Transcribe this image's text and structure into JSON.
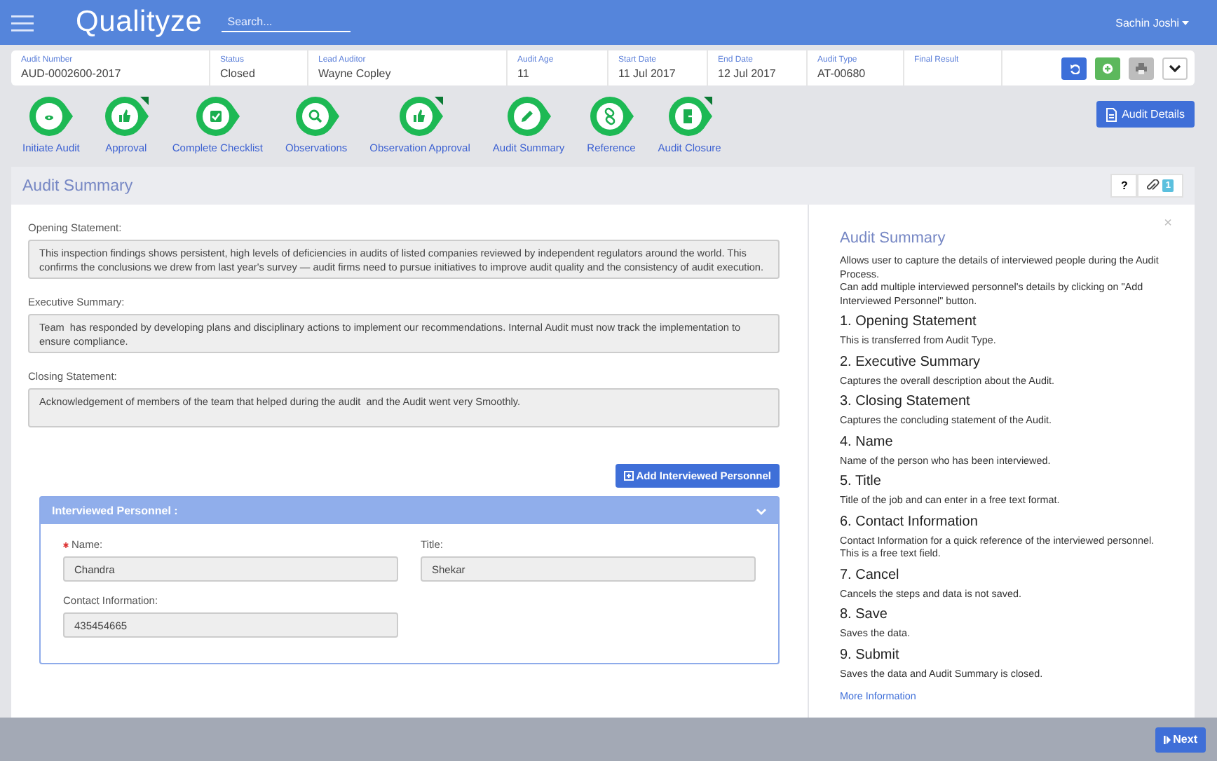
{
  "header": {
    "brand": "Qualityze",
    "search": {
      "placeholder": "Search..."
    },
    "user": "Sachin Joshi"
  },
  "audit_info": [
    {
      "label": "Audit Number",
      "value": "AUD-0002600-2017"
    },
    {
      "label": "Status",
      "value": "Closed"
    },
    {
      "label": "Lead Auditor",
      "value": "Wayne Copley"
    },
    {
      "label": "Audit Age",
      "value": "11"
    },
    {
      "label": "Start Date",
      "value": "11 Jul 2017"
    },
    {
      "label": "End Date",
      "value": "12 Jul 2017"
    },
    {
      "label": "Audit Type",
      "value": "AT-00680"
    },
    {
      "label": "Final Result"
    }
  ],
  "steps": [
    {
      "label": "Initiate Audit",
      "flagged": false
    },
    {
      "label": "Approval",
      "flagged": true
    },
    {
      "label": "Complete Checklist",
      "flagged": false
    },
    {
      "label": "Observations",
      "flagged": false
    },
    {
      "label": "Observation Approval",
      "flagged": true
    },
    {
      "label": "Audit Summary",
      "flagged": false
    },
    {
      "label": "Reference",
      "flagged": false
    },
    {
      "label": "Audit Closure",
      "flagged": true
    }
  ],
  "audit_details_button": "Audit Details",
  "panel": {
    "title": "Audit Summary",
    "help_button": "?",
    "attachment_count": "1"
  },
  "statements": [
    {
      "label": "Opening Statement:",
      "value": "This inspection findings shows persistent, high levels of deficiencies in audits of listed companies reviewed by independent regulators around the world. This confirms the conclusions we drew from last year's survey — audit firms need to pursue initiatives to improve audit quality and the consistency of audit execution."
    },
    {
      "label": "Executive Summary:",
      "value": "Team  has responded by developing plans and disciplinary actions to implement our recommendations. Internal Audit must now track the implementation to ensure compliance."
    },
    {
      "label": "Closing Statement:",
      "value": "Acknowledgement of members of the team that helped during the audit  and the Audit went very Smoothly."
    }
  ],
  "add_personnel_button": "Add Interviewed Personnel",
  "personnel": {
    "title": "Interviewed Personnel :",
    "expanded": true,
    "fields": [
      {
        "label": "Name:",
        "required": true,
        "value": "Chandra"
      },
      {
        "label": "Title:",
        "required": false,
        "value": "Shekar"
      },
      {
        "label": "Contact Information:",
        "required": false,
        "value": "435454665"
      }
    ]
  },
  "help": {
    "close": "×",
    "title": "Audit Summary",
    "intro": [
      "Allows user to capture the details of interviewed people during the Audit Process.",
      "Can add multiple interviewed personnel's details by clicking on \"Add Interviewed Personnel\" button."
    ],
    "sections": [
      {
        "heading": "1. Opening Statement",
        "text": "This is transferred from Audit Type."
      },
      {
        "heading": "2. Executive Summary",
        "text": "Captures the overall description about the Audit."
      },
      {
        "heading": "3. Closing Statement",
        "text": "Captures the concluding statement of the Audit."
      },
      {
        "heading": "4. Name",
        "text": "Name of the person who has been interviewed."
      },
      {
        "heading": "5. Title",
        "text": "Title of the job and can enter in a free text format."
      },
      {
        "heading": "6. Contact Information",
        "text": "Contact Information for a quick reference of the interviewed personnel. This is a free text field."
      },
      {
        "heading": "7. Cancel",
        "text": "Cancels the steps and data is not saved."
      },
      {
        "heading": "8. Save",
        "text": "Saves the data."
      },
      {
        "heading": "9. Submit",
        "text": "Saves the data and Audit Summary is closed."
      }
    ],
    "link": "More Information"
  },
  "footer": {
    "next_button": "Next"
  }
}
